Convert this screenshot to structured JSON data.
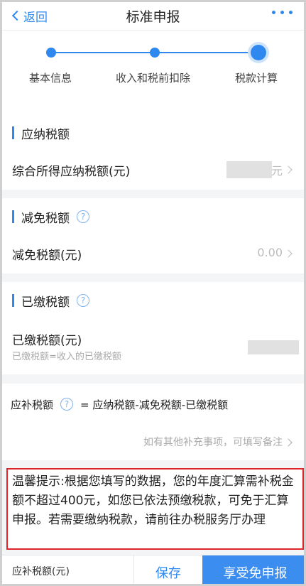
{
  "nav": {
    "back_label": "返回",
    "title": "标准申报"
  },
  "steps": [
    "基本信息",
    "收入和税前扣除",
    "税款计算"
  ],
  "section_payable": {
    "title": "应纳税额",
    "row_label": "综合所得应纳税额(元)",
    "row_unit": "元"
  },
  "section_relief": {
    "title": "减免税额",
    "row_label": "减免税额(元)",
    "row_value": "0.00"
  },
  "section_paid": {
    "title": "已缴税额",
    "row_label": "已缴税额(元)",
    "row_sub": "已缴税额=收入的已缴税额"
  },
  "formula": {
    "label": "应补税额",
    "expression": "= 应纳税额-减免税额-已缴税额"
  },
  "note_link": "如有其他补充事项，可填写备注",
  "tip": "温馨提示:根据您填写的数据，您的年度汇算需补税金额不超过400元，如您已依法预缴税款，可免于汇算申报。若需要缴纳税款，请前往办税服务厅办理",
  "bottom": {
    "label": "应补税额(元)",
    "save": "保存",
    "submit": "享受免申报"
  },
  "colors": {
    "accent": "#2f88ee",
    "highlight_border": "#e0242b"
  }
}
